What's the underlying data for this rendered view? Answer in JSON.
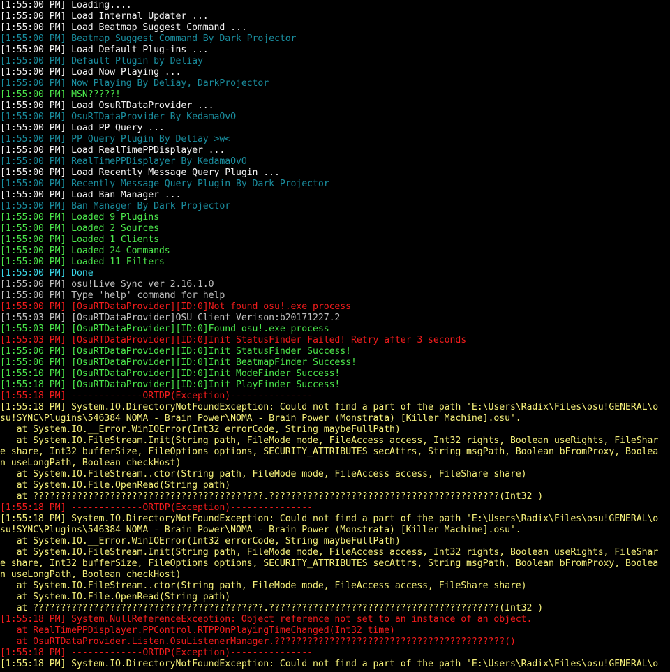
{
  "colors": {
    "background": "#000000",
    "white": "#f2f2f2",
    "gray": "#c0c0c0",
    "teal": "#1a8d9e",
    "green": "#4be64b",
    "cyan": "#3ad8e8",
    "red": "#f21c1c",
    "yellow": "#f5f07a"
  },
  "console_lines": [
    {
      "text": "[1:55:00 PM] Loading....",
      "color": "white"
    },
    {
      "text": "[1:55:00 PM] Load Internal Updater ...",
      "color": "white"
    },
    {
      "text": "[1:55:00 PM] Load Beatmap Suggest Command ...",
      "color": "white"
    },
    {
      "text": "[1:55:00 PM] Beatmap Suggest Command By Dark Projector",
      "color": "teal"
    },
    {
      "text": "[1:55:00 PM] Load Default Plug-ins ...",
      "color": "white"
    },
    {
      "text": "[1:55:00 PM] Default Plugin by Deliay",
      "color": "teal"
    },
    {
      "text": "[1:55:00 PM] Load Now Playing ...",
      "color": "white"
    },
    {
      "text": "[1:55:00 PM] Now Playing By Deliay, DarkProjector",
      "color": "teal"
    },
    {
      "text": "[1:55:00 PM] MSN?????!",
      "color": "green"
    },
    {
      "text": "[1:55:00 PM] Load OsuRTDataProvider ...",
      "color": "white"
    },
    {
      "text": "[1:55:00 PM] OsuRTDataProvider By KedamaOvO",
      "color": "teal"
    },
    {
      "text": "[1:55:00 PM] Load PP Query ...",
      "color": "white"
    },
    {
      "text": "[1:55:00 PM] PP Query Plugin By Deliay >w<",
      "color": "teal"
    },
    {
      "text": "[1:55:00 PM] Load RealTimePPDisplayer ...",
      "color": "white"
    },
    {
      "text": "[1:55:00 PM] RealTimePPDisplayer By KedamaOvO",
      "color": "teal"
    },
    {
      "text": "[1:55:00 PM] Load Recently Message Query Plugin ...",
      "color": "white"
    },
    {
      "text": "[1:55:00 PM] Recently Message Query Plugin By Dark Projector",
      "color": "teal"
    },
    {
      "text": "[1:55:00 PM] Load Ban Manager ...",
      "color": "white"
    },
    {
      "text": "[1:55:00 PM] Ban Manager By Dark Projector",
      "color": "teal"
    },
    {
      "text": "[1:55:00 PM] Loaded 9 Plugins",
      "color": "green"
    },
    {
      "text": "[1:55:00 PM] Loaded 2 Sources",
      "color": "green"
    },
    {
      "text": "[1:55:00 PM] Loaded 1 Clients",
      "color": "green"
    },
    {
      "text": "[1:55:00 PM] Loaded 24 Commands",
      "color": "green"
    },
    {
      "text": "[1:55:00 PM] Loaded 11 Filters",
      "color": "green"
    },
    {
      "text": "[1:55:00 PM] Done",
      "color": "cyan"
    },
    {
      "text": "[1:55:00 PM] osu!Live Sync ver 2.16.1.0",
      "color": "gray"
    },
    {
      "text": "[1:55:00 PM] Type 'help' command for help",
      "color": "gray"
    },
    {
      "text": "[1:55:00 PM] [OsuRTDataProvider][ID:0]Not found osu!.exe process",
      "color": "red"
    },
    {
      "text": "[1:55:03 PM] [OsuRTDataProvider]OSU Client Verison:b20171227.2",
      "color": "gray"
    },
    {
      "text": "[1:55:03 PM] [OsuRTDataProvider][ID:0]Found osu!.exe process",
      "color": "green"
    },
    {
      "text": "[1:55:03 PM] [OsuRTDataProvider][ID:0]Init StatusFinder Failed! Retry after 3 seconds",
      "color": "red"
    },
    {
      "text": "[1:55:06 PM] [OsuRTDataProvider][ID:0]Init StatusFinder Success!",
      "color": "green"
    },
    {
      "text": "[1:55:06 PM] [OsuRTDataProvider][ID:0]Init BeatmapFinder Success!",
      "color": "green"
    },
    {
      "text": "[1:55:10 PM] [OsuRTDataProvider][ID:0]Init ModeFinder Success!",
      "color": "green"
    },
    {
      "text": "[1:55:18 PM] [OsuRTDataProvider][ID:0]Init PlayFinder Success!",
      "color": "green"
    },
    {
      "text": "[1:55:18 PM] -------------ORTDP(Exception)---------------",
      "color": "red"
    },
    {
      "text": "[1:55:18 PM] System.IO.DirectoryNotFoundException: Could not find a part of the path 'E:\\Users\\Radix\\Files\\osu!GENERAL\\o",
      "color": "yellow"
    },
    {
      "text": "su!SYNC\\Plugins\\546384 NOMA - Brain Power\\NOMA - Brain Power (Monstrata) [Killer Machine].osu'.",
      "color": "yellow"
    },
    {
      "text": "   at System.IO.__Error.WinIOError(Int32 errorCode, String maybeFullPath)",
      "color": "yellow"
    },
    {
      "text": "   at System.IO.FileStream.Init(String path, FileMode mode, FileAccess access, Int32 rights, Boolean useRights, FileShar",
      "color": "yellow"
    },
    {
      "text": "e share, Int32 bufferSize, FileOptions options, SECURITY_ATTRIBUTES secAttrs, String msgPath, Boolean bFromProxy, Boolea",
      "color": "yellow"
    },
    {
      "text": "n useLongPath, Boolean checkHost)",
      "color": "yellow"
    },
    {
      "text": "   at System.IO.FileStream..ctor(String path, FileMode mode, FileAccess access, FileShare share)",
      "color": "yellow"
    },
    {
      "text": "   at System.IO.File.OpenRead(String path)",
      "color": "yellow"
    },
    {
      "text": "   at ??????????????????????????????????????????.??????????????????????????????????????????(Int32 )",
      "color": "yellow"
    },
    {
      "text": "[1:55:18 PM] -------------ORTDP(Exception)---------------",
      "color": "red"
    },
    {
      "text": "[1:55:18 PM] System.IO.DirectoryNotFoundException: Could not find a part of the path 'E:\\Users\\Radix\\Files\\osu!GENERAL\\o",
      "color": "yellow"
    },
    {
      "text": "su!SYNC\\Plugins\\546384 NOMA - Brain Power\\NOMA - Brain Power (Monstrata) [Killer Machine].osu'.",
      "color": "yellow"
    },
    {
      "text": "   at System.IO.__Error.WinIOError(Int32 errorCode, String maybeFullPath)",
      "color": "yellow"
    },
    {
      "text": "   at System.IO.FileStream.Init(String path, FileMode mode, FileAccess access, Int32 rights, Boolean useRights, FileShar",
      "color": "yellow"
    },
    {
      "text": "e share, Int32 bufferSize, FileOptions options, SECURITY_ATTRIBUTES secAttrs, String msgPath, Boolean bFromProxy, Boolea",
      "color": "yellow"
    },
    {
      "text": "n useLongPath, Boolean checkHost)",
      "color": "yellow"
    },
    {
      "text": "   at System.IO.FileStream..ctor(String path, FileMode mode, FileAccess access, FileShare share)",
      "color": "yellow"
    },
    {
      "text": "   at System.IO.File.OpenRead(String path)",
      "color": "yellow"
    },
    {
      "text": "   at ??????????????????????????????????????????.??????????????????????????????????????????(Int32 )",
      "color": "yellow"
    },
    {
      "text": "[1:55:18 PM] System.NullReferenceException: Object reference not set to an instance of an object.",
      "color": "red"
    },
    {
      "text": "   at RealTimePPDisplayer.PPControl.RTPPOnPlayingTimeChanged(Int32 time)",
      "color": "red"
    },
    {
      "text": "   at OsuRTDataProvider.Listen.OsuListenerManager.??????????????????????????????????????????()",
      "color": "red"
    },
    {
      "text": "[1:55:18 PM] -------------ORTDP(Exception)---------------",
      "color": "red"
    },
    {
      "text": "[1:55:18 PM] System.IO.DirectoryNotFoundException: Could not find a part of the path 'E:\\Users\\Radix\\Files\\osu!GENERAL\\o",
      "color": "yellow"
    }
  ]
}
